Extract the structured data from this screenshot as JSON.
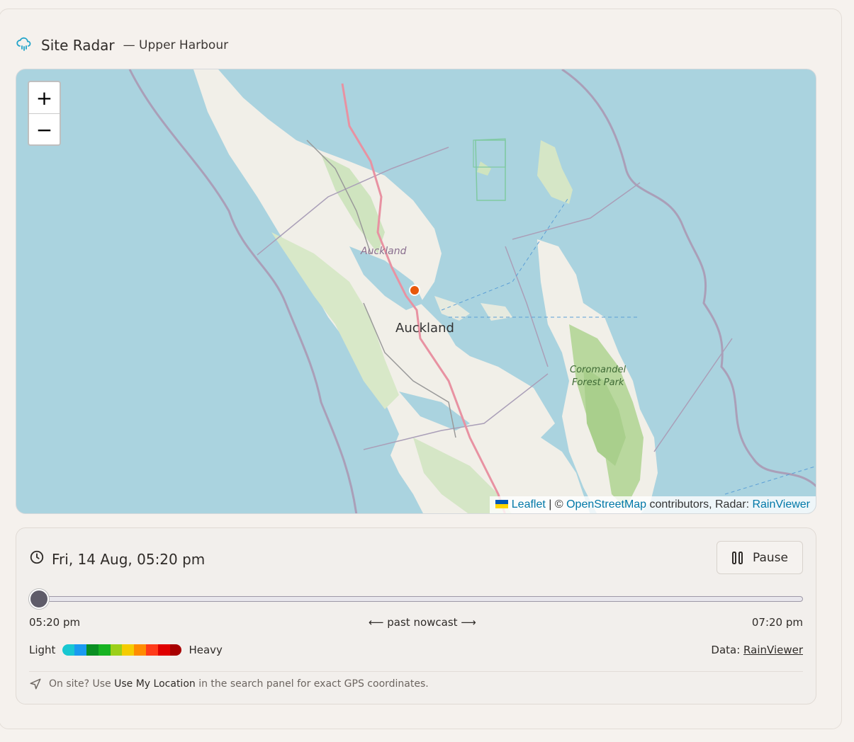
{
  "header": {
    "title": "Site Radar",
    "subtitle": "— Upper Harbour"
  },
  "map": {
    "zoom_in": "+",
    "zoom_out": "−",
    "labels": {
      "region": "Auckland",
      "city": "Auckland",
      "park_line1": "Coromandel",
      "park_line2": "Forest Park"
    },
    "attribution": {
      "leaflet": "Leaflet",
      "sep": " | © ",
      "osm": "OpenStreetMap",
      "contrib": " contributors, Radar: ",
      "rainviewer": "RainViewer"
    }
  },
  "controls": {
    "timestamp": "Fri, 14 Aug, 05:20 pm",
    "pause_label": "Pause",
    "slider_position": 0,
    "time_start": "05:20 pm",
    "time_middle": "⟵ past  nowcast ⟶",
    "time_end": "07:20 pm",
    "legend_light": "Light",
    "legend_heavy": "Heavy",
    "legend_colors": [
      "#18c7d1",
      "#1a9af0",
      "#0a8f22",
      "#17b321",
      "#9ccf19",
      "#f5cc00",
      "#ff8c00",
      "#ff3b1a",
      "#e00000",
      "#a80000"
    ],
    "data_prefix": "Data: ",
    "data_link": "RainViewer",
    "tip_prefix": "On site? Use ",
    "tip_bold": "Use My Location",
    "tip_suffix": " in the search panel for exact GPS coordinates."
  }
}
